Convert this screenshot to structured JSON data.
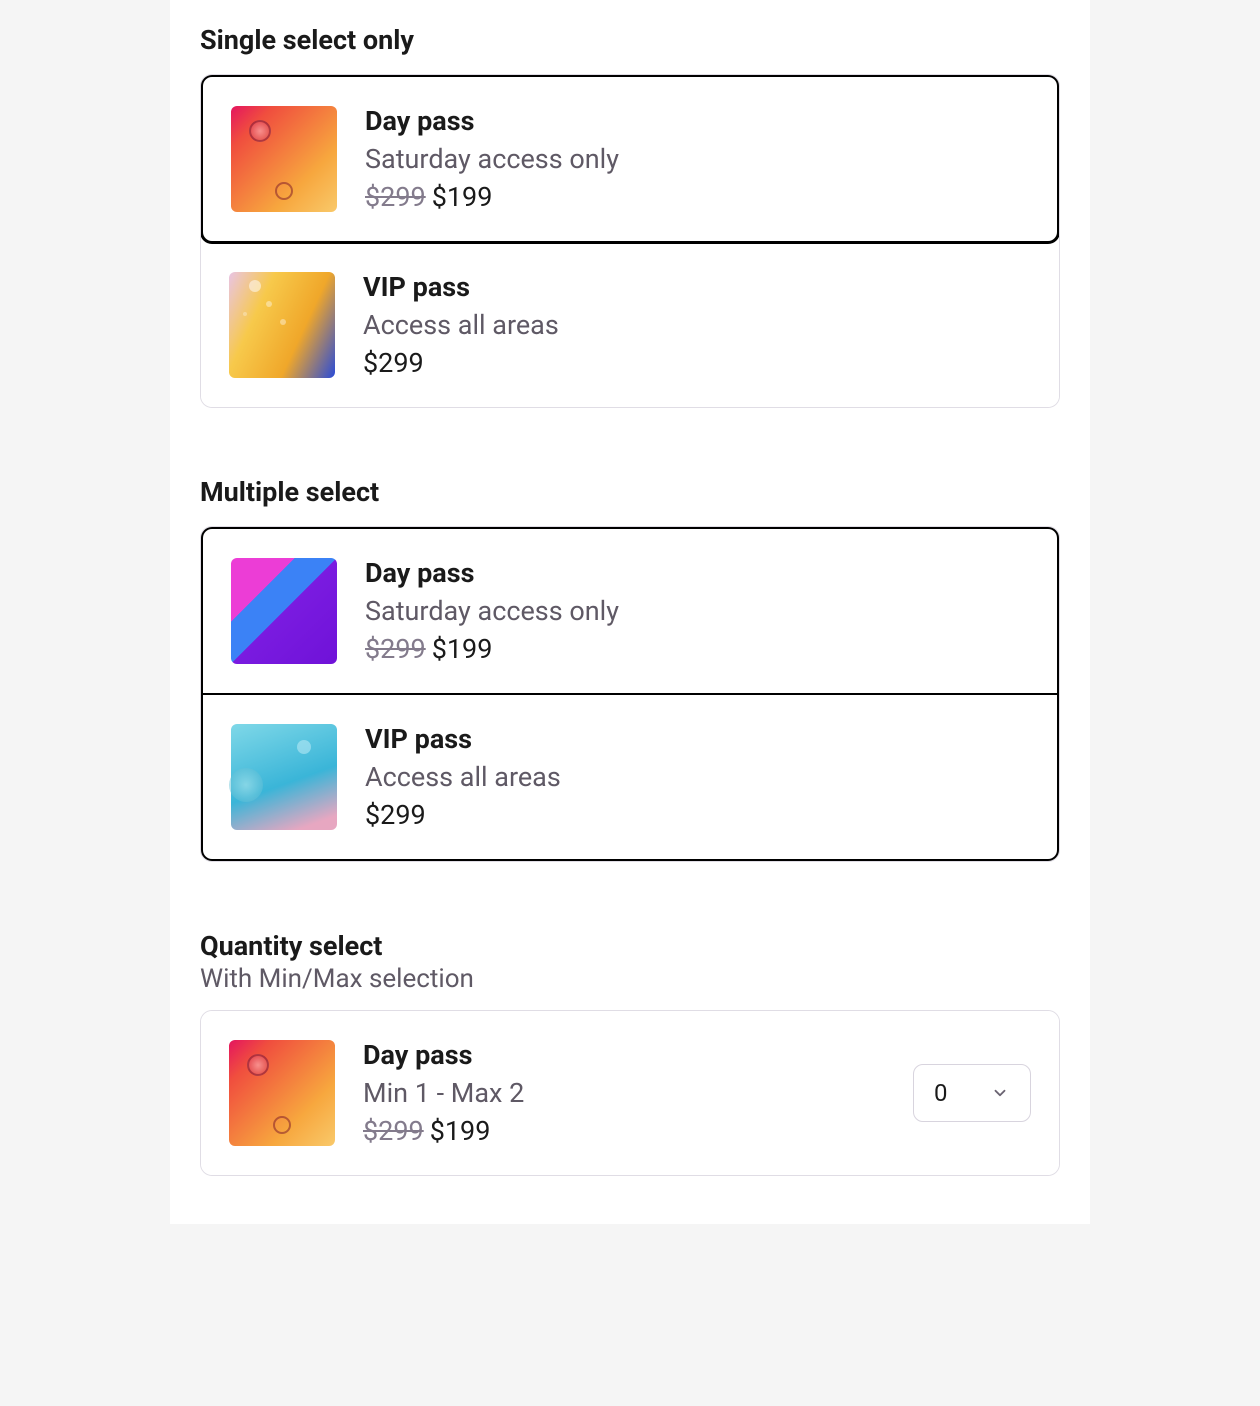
{
  "sections": {
    "single": {
      "title": "Single select only",
      "items": [
        {
          "title": "Day pass",
          "desc": "Saturday access only",
          "old_price": "$299",
          "price": "$199"
        },
        {
          "title": "VIP pass",
          "desc": "Access all areas",
          "price": "$299"
        }
      ]
    },
    "multiple": {
      "title": "Multiple select",
      "items": [
        {
          "title": "Day pass",
          "desc": "Saturday access only",
          "old_price": "$299",
          "price": "$199"
        },
        {
          "title": "VIP pass",
          "desc": "Access all areas",
          "price": "$299"
        }
      ]
    },
    "quantity": {
      "title": "Quantity select",
      "subtitle": "With Min/Max selection",
      "items": [
        {
          "title": "Day pass",
          "desc": "Min 1 - Max 2",
          "old_price": "$299",
          "price": "$199",
          "qty": "0"
        }
      ]
    }
  }
}
